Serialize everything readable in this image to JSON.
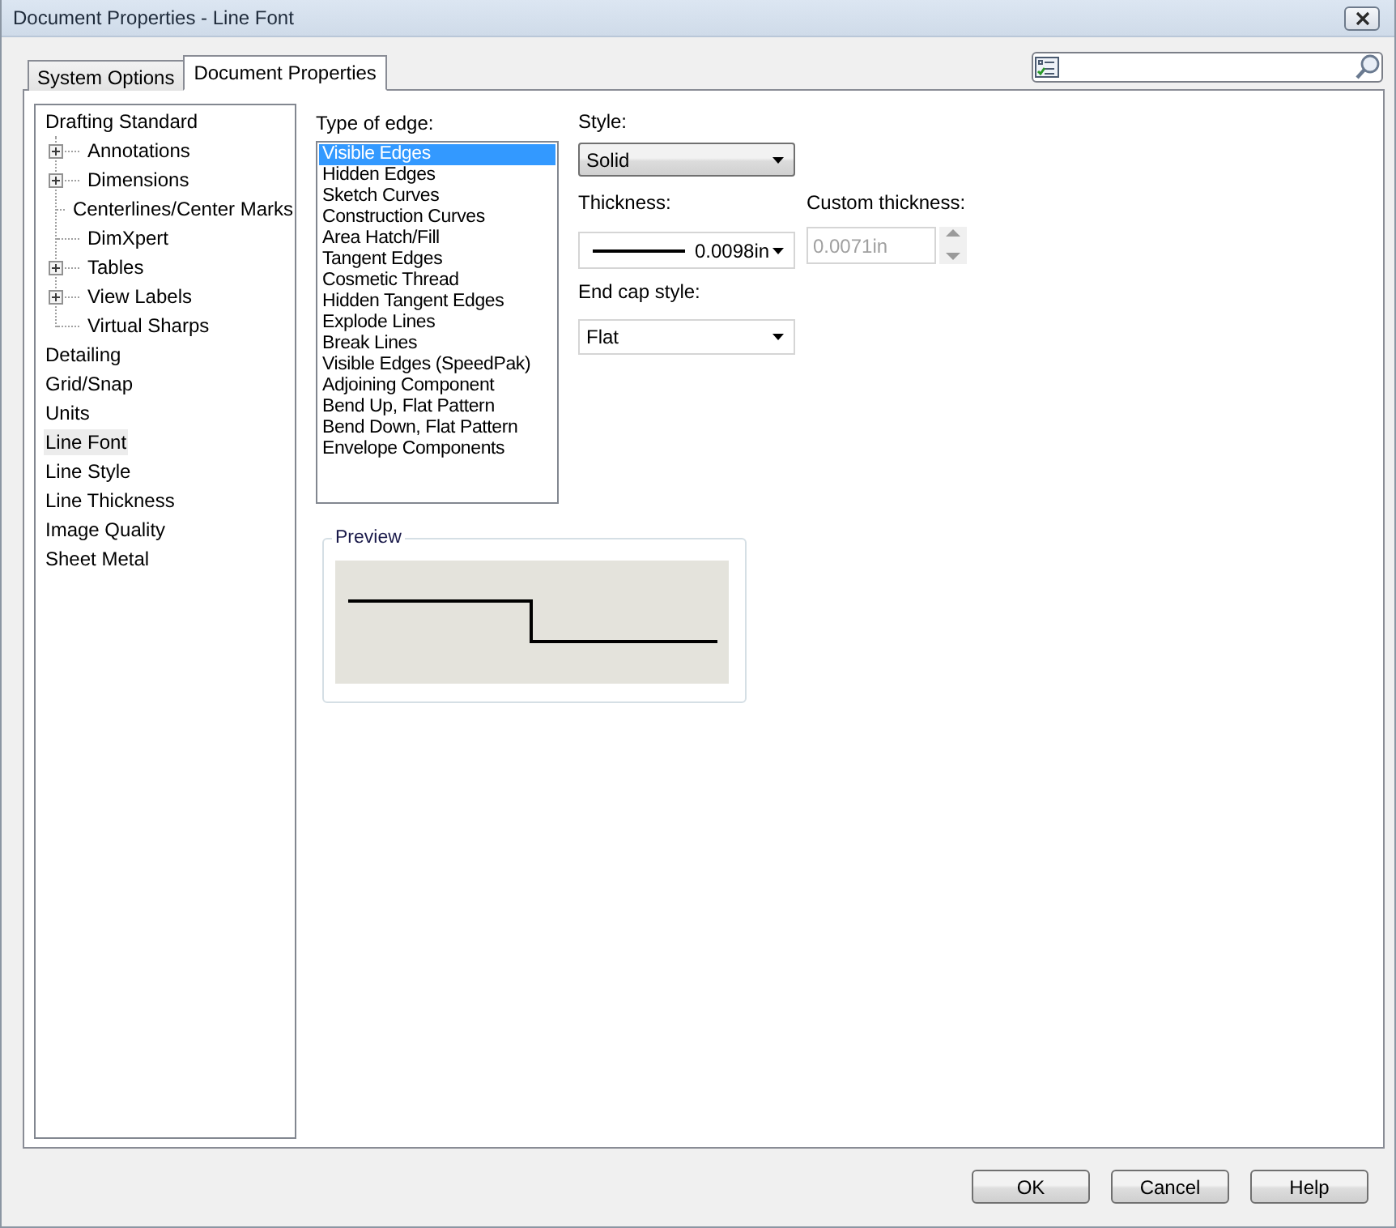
{
  "window": {
    "title": "Document Properties - Line Font"
  },
  "tabs": [
    {
      "label": "System Options",
      "selected": false
    },
    {
      "label": "Document Properties",
      "selected": true
    }
  ],
  "tree": [
    {
      "label": "Drafting Standard",
      "selected": false,
      "children": [
        {
          "label": "Annotations",
          "expandable": true,
          "selected": false
        },
        {
          "label": "Dimensions",
          "expandable": true,
          "selected": false
        },
        {
          "label": "Centerlines/Center Marks",
          "expandable": false,
          "selected": false
        },
        {
          "label": "DimXpert",
          "expandable": false,
          "selected": false
        },
        {
          "label": "Tables",
          "expandable": true,
          "selected": false
        },
        {
          "label": "View Labels",
          "expandable": true,
          "selected": false
        },
        {
          "label": "Virtual Sharps",
          "expandable": false,
          "selected": false
        }
      ]
    },
    {
      "label": "Detailing",
      "selected": false
    },
    {
      "label": "Grid/Snap",
      "selected": false
    },
    {
      "label": "Units",
      "selected": false
    },
    {
      "label": "Line Font",
      "selected": true
    },
    {
      "label": "Line Style",
      "selected": false
    },
    {
      "label": "Line Thickness",
      "selected": false
    },
    {
      "label": "Image Quality",
      "selected": false
    },
    {
      "label": "Sheet Metal",
      "selected": false
    }
  ],
  "edge_types": {
    "label": "Type of edge:",
    "items": [
      {
        "label": "Visible Edges",
        "selected": true
      },
      {
        "label": "Hidden Edges",
        "selected": false
      },
      {
        "label": "Sketch Curves",
        "selected": false
      },
      {
        "label": "Construction Curves",
        "selected": false
      },
      {
        "label": "Area Hatch/Fill",
        "selected": false
      },
      {
        "label": "Tangent Edges",
        "selected": false
      },
      {
        "label": "Cosmetic Thread",
        "selected": false
      },
      {
        "label": "Hidden Tangent Edges",
        "selected": false
      },
      {
        "label": "Explode Lines",
        "selected": false
      },
      {
        "label": "Break Lines",
        "selected": false
      },
      {
        "label": "Visible Edges (SpeedPak)",
        "selected": false
      },
      {
        "label": "Adjoining Component",
        "selected": false
      },
      {
        "label": "Bend Up, Flat Pattern",
        "selected": false
      },
      {
        "label": "Bend Down, Flat Pattern",
        "selected": false
      },
      {
        "label": "Envelope Components",
        "selected": false
      }
    ]
  },
  "style": {
    "label": "Style:",
    "value": "Solid"
  },
  "thickness": {
    "label": "Thickness:",
    "value": "0.0098in"
  },
  "custom_thickness": {
    "label": "Custom thickness:",
    "value": "0.0071in",
    "disabled": true
  },
  "end_cap": {
    "label": "End cap style:",
    "value": "Flat"
  },
  "preview": {
    "label": "Preview"
  },
  "buttons": [
    "OK",
    "Cancel",
    "Help"
  ]
}
